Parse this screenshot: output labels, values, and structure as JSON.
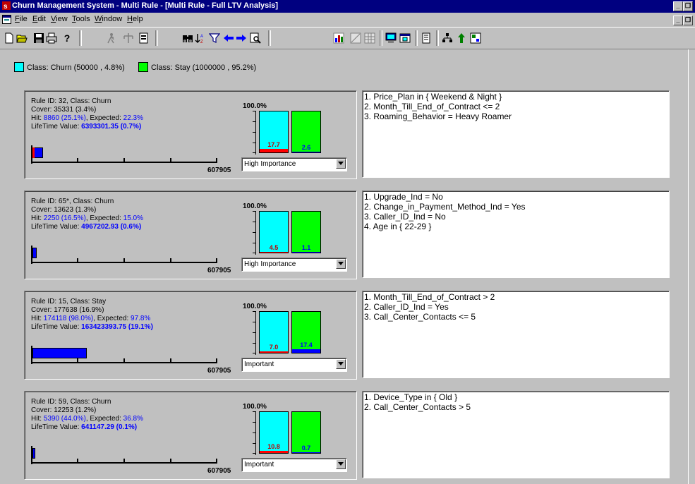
{
  "window": {
    "title": "Churn Management System - Multi Rule - [Multi Rule - Full LTV Analysis]",
    "controls": [
      "_",
      "❐"
    ]
  },
  "menubar": {
    "items": [
      {
        "label": "File",
        "key": "F",
        "rest": "ile"
      },
      {
        "label": "Edit",
        "key": "E",
        "rest": "dit"
      },
      {
        "label": "View",
        "key": "V",
        "rest": "iew"
      },
      {
        "label": "Tools",
        "key": "T",
        "rest": "ools"
      },
      {
        "label": "Window",
        "key": "W",
        "rest": "indow"
      },
      {
        "label": "Help",
        "key": "H",
        "rest": "elp"
      }
    ]
  },
  "toolbar": {
    "help_label": "?",
    "icons": [
      "new-icon",
      "open-icon",
      "save-icon",
      "print-icon",
      "help-icon",
      "run-icon",
      "split-icon",
      "export-icon",
      "binoculars-icon",
      "sort-icon",
      "filter-icon",
      "back-arrow-icon",
      "forward-arrow-icon",
      "zoom-icon",
      "bar-chart-icon",
      "table-icon",
      "grid-icon",
      "view-icon",
      "window-icon",
      "document-icon",
      "tree-icon",
      "up-icon",
      "layout-icon"
    ]
  },
  "legend": {
    "churn": {
      "label": "Class: Churn (50000 , 4.8%)",
      "color": "#00ffff"
    },
    "stay": {
      "label": "Class: Stay (1000000 , 95.2%)",
      "color": "#00ff00"
    }
  },
  "axis_max_label": "607905",
  "rules": [
    {
      "header": "Rule ID: 32, Class: Churn",
      "cover": "Cover: 35331 (3.4%)",
      "hit_prefix": "Hit: ",
      "hit_value": "8860  (25.1%)",
      "expected_prefix": ", Expected: ",
      "expected_value": "22.3%",
      "ltv_prefix": "LifeTime Value: ",
      "ltv_value": "6393301.35 (0.7%)",
      "ltv_fraction": 0.058,
      "pct_label": "100.0%",
      "churn_value": "17.7",
      "stay_value": "2.6",
      "churn_fill": 0.177,
      "stay_fill": 0.026,
      "importance": "High Importance",
      "conditions": [
        "1. Price_Plan in { Weekend & Night }",
        "2. Month_Till_End_of_Contract <= 2",
        "3. Roaming_Behavior = Heavy Roamer"
      ]
    },
    {
      "header": "Rule ID: 65*, Class: Churn",
      "cover": "Cover: 13623 (1.3%)",
      "hit_prefix": "Hit: ",
      "hit_value": "2250  (16.5%)",
      "expected_prefix": ", Expected: ",
      "expected_value": "15.0%",
      "ltv_prefix": "LifeTime Value: ",
      "ltv_value": "4967202.93 (0.6%)",
      "ltv_fraction": 0.022,
      "pct_label": "100.0%",
      "churn_value": "4.5",
      "stay_value": "1.1",
      "churn_fill": 0.045,
      "stay_fill": 0.011,
      "importance": "High Importance",
      "conditions": [
        "1. Upgrade_Ind = No",
        "2. Change_in_Payment_Method_Ind = Yes",
        "3. Caller_ID_Ind = No",
        "4. Age in { 22-29 }"
      ]
    },
    {
      "header": "Rule ID: 15, Class: Stay",
      "cover": "Cover: 177638 (16.9%)",
      "hit_prefix": "Hit: ",
      "hit_value": "174118  (98.0%)",
      "expected_prefix": ", Expected: ",
      "expected_value": "97.8%",
      "ltv_prefix": "LifeTime Value: ",
      "ltv_value": "163423393.75 (19.1%)",
      "ltv_fraction": 0.292,
      "pct_label": "100.0%",
      "churn_value": "7.0",
      "stay_value": "17.4",
      "churn_fill": 0.07,
      "stay_fill": 0.174,
      "importance": "Important",
      "conditions": [
        "1. Month_Till_End_of_Contract > 2",
        "2. Caller_ID_Ind = Yes",
        "3. Call_Center_Contacts <= 5"
      ]
    },
    {
      "header": "Rule ID: 59, Class: Churn",
      "cover": "Cover: 12253 (1.2%)",
      "hit_prefix": "Hit: ",
      "hit_value": "5390  (44.0%)",
      "expected_prefix": ", Expected: ",
      "expected_value": "36.8%",
      "ltv_prefix": "LifeTime Value: ",
      "ltv_value": "641147.29 (0.1%)",
      "ltv_fraction": 0.012,
      "pct_label": "100.0%",
      "churn_value": "10.8",
      "stay_value": "0.7",
      "churn_fill": 0.108,
      "stay_fill": 0.007,
      "importance": "Important",
      "conditions": [
        "1. Device_Type in { Old }",
        "2. Call_Center_Contacts > 5"
      ]
    }
  ]
}
